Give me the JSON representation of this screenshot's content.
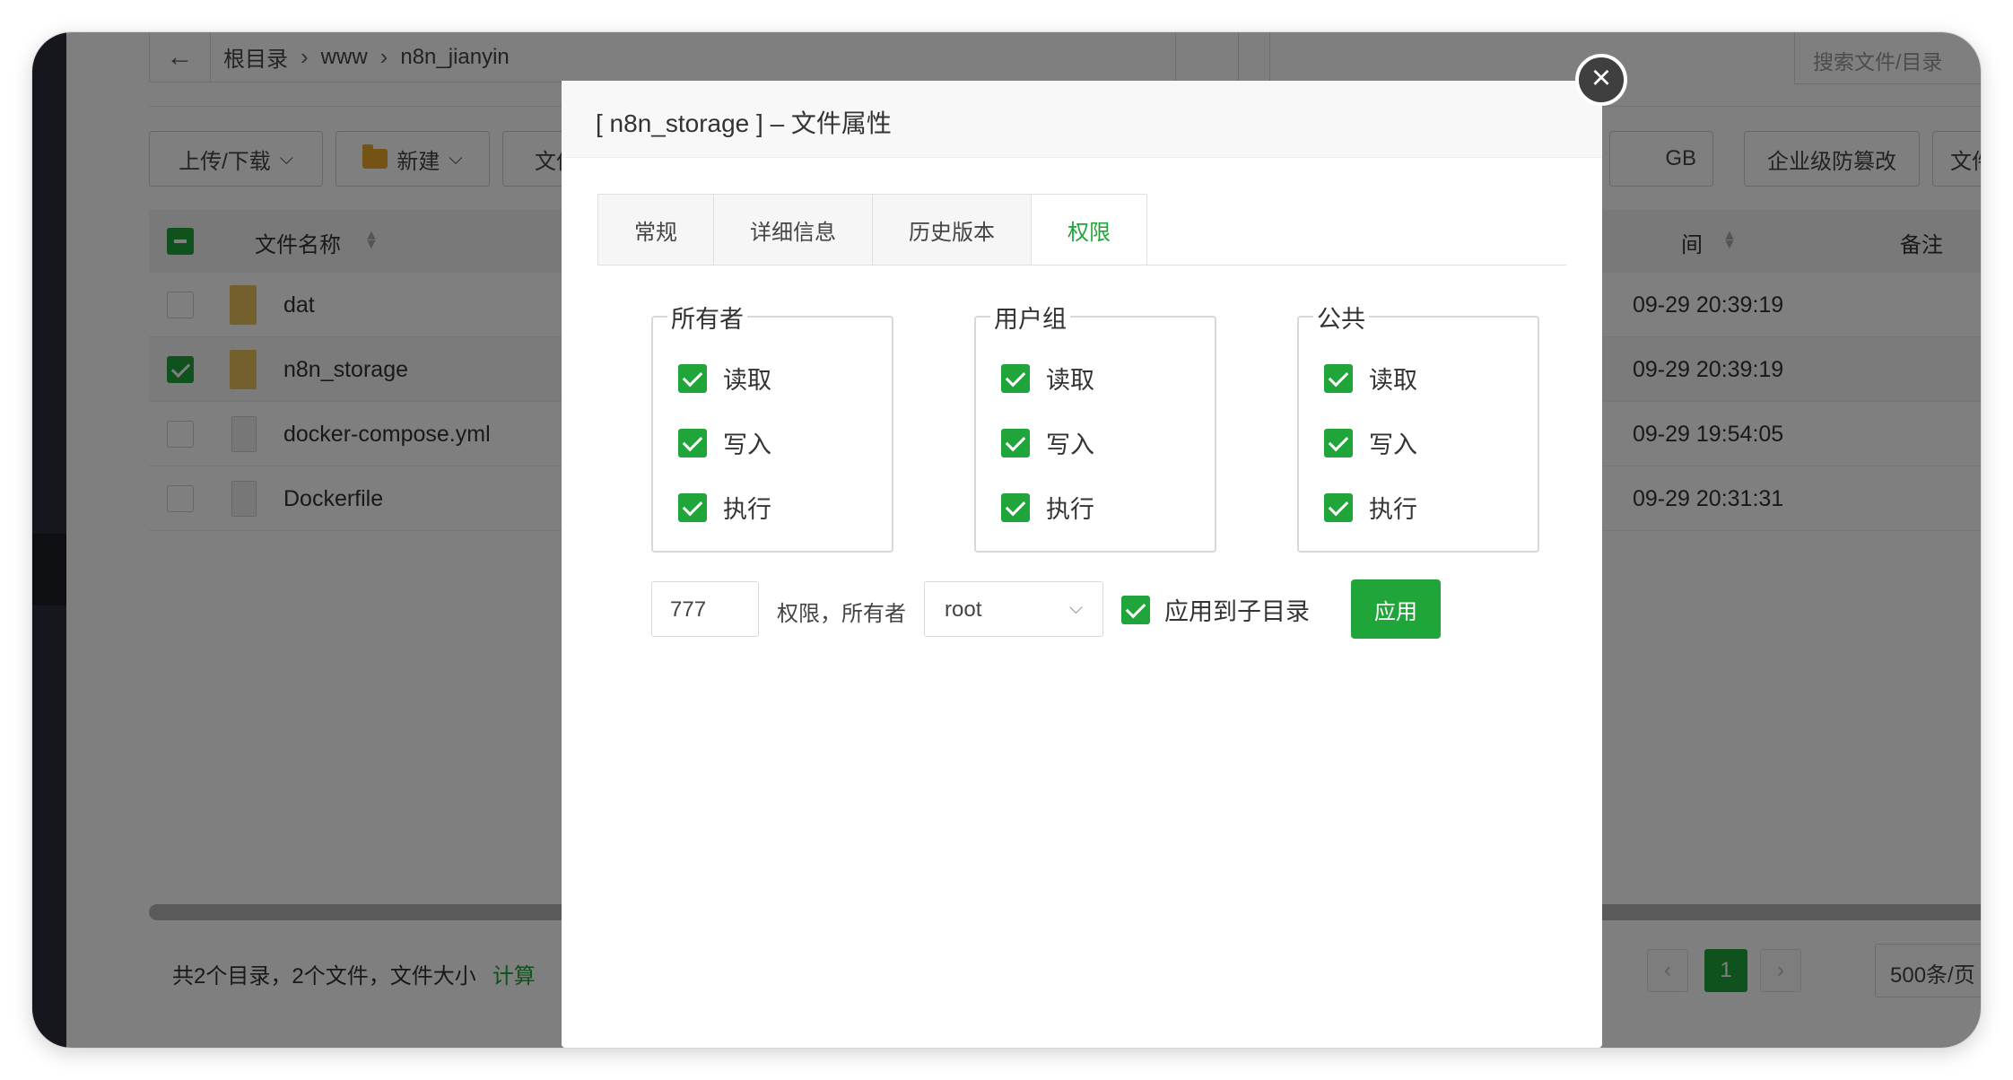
{
  "path": {
    "back_icon": "arrow-left-icon",
    "crumbs": [
      "根目录",
      "www",
      "n8n_jianyin"
    ],
    "search_placeholder": "搜索文件/目录"
  },
  "toolbar": {
    "upload": "上传/下载",
    "new": "新建",
    "file": "文件",
    "disk": "GB",
    "tamper": "企业级防篡改",
    "sync": "文件同步"
  },
  "table": {
    "col_name": "文件名称",
    "col_time": "间",
    "col_note": "备注",
    "rows": [
      {
        "name": "dat",
        "time": "09-29 20:39:19",
        "type": "folder",
        "checked": false
      },
      {
        "name": "n8n_storage",
        "time": "09-29 20:39:19",
        "type": "folder",
        "checked": true
      },
      {
        "name": "docker-compose.yml",
        "time": "09-29 19:54:05",
        "type": "file",
        "checked": false
      },
      {
        "name": "Dockerfile",
        "time": "09-29 20:31:31",
        "type": "file",
        "checked": false
      }
    ]
  },
  "footer": {
    "summary": "共2个目录，2个文件，文件大小",
    "calc": "计算",
    "page": "1",
    "page_size": "500条/页",
    "prev": "‹",
    "next": "›"
  },
  "modal": {
    "title": "[ n8n_storage ] – 文件属性",
    "close": "×",
    "tabs": [
      "常规",
      "详细信息",
      "历史版本",
      "权限"
    ],
    "active_tab": 3,
    "groups": [
      {
        "label": "所有者",
        "items": [
          "读取",
          "写入",
          "执行"
        ]
      },
      {
        "label": "用户组",
        "items": [
          "读取",
          "写入",
          "执行"
        ]
      },
      {
        "label": "公共",
        "items": [
          "读取",
          "写入",
          "执行"
        ]
      }
    ],
    "perm_value": "777",
    "perm_label": "权限，所有者",
    "owner": "root",
    "apply_sub_label": "应用到子目录",
    "apply_button": "应用"
  },
  "colors": {
    "accent": "#20a53a"
  }
}
